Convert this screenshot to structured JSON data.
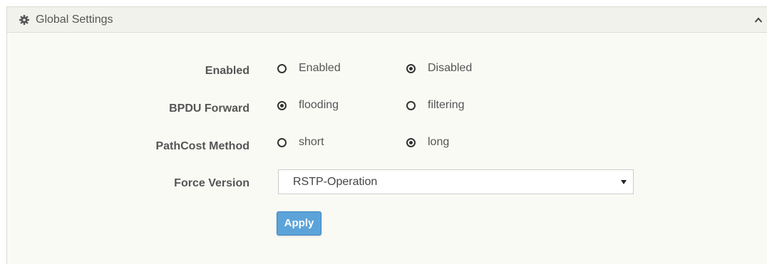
{
  "panel": {
    "title": "Global Settings",
    "header_icon": "gear-icon",
    "collapse_icon": "chevron-up-icon"
  },
  "form": {
    "enabled": {
      "label": "Enabled",
      "options": [
        {
          "label": "Enabled",
          "checked": false
        },
        {
          "label": "Disabled",
          "checked": true
        }
      ]
    },
    "bpdu_forward": {
      "label": "BPDU Forward",
      "options": [
        {
          "label": "flooding",
          "checked": true
        },
        {
          "label": "filtering",
          "checked": false
        }
      ]
    },
    "pathcost_method": {
      "label": "PathCost Method",
      "options": [
        {
          "label": "short",
          "checked": false
        },
        {
          "label": "long",
          "checked": true
        }
      ]
    },
    "force_version": {
      "label": "Force Version",
      "selected": "RSTP-Operation"
    },
    "apply_label": "Apply"
  },
  "colors": {
    "panel_bg": "#fafaf5",
    "header_bg": "#f2f2ec",
    "text": "#555555",
    "button_bg": "#5ba3d9"
  }
}
